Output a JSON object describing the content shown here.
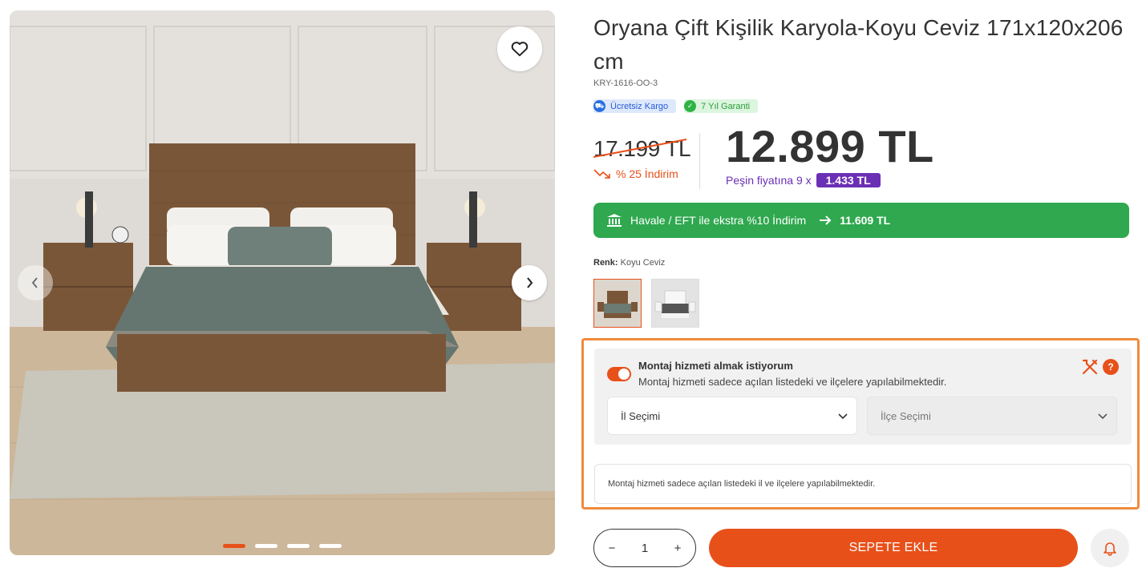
{
  "product": {
    "title": "Oryana Çift Kişilik Karyola-Koyu Ceviz 171x120x206 cm",
    "sku": "KRY-1616-OO-3",
    "badges": [
      {
        "label": "Ücretsiz Kargo",
        "icon": "shipping-icon"
      },
      {
        "label": "7 Yıl Garanti",
        "icon": "check-icon"
      }
    ]
  },
  "price": {
    "old": "17.199 TL",
    "discount": "% 25 İndirim",
    "current": "12.899 TL",
    "installment_text": "Peşin fiyatına 9 x",
    "installment_amount": "1.433 TL"
  },
  "havale": {
    "text": "Havale / EFT ile ekstra %10 İndirim",
    "amount": "11.609  TL"
  },
  "color": {
    "label": "Renk:",
    "value": "Koyu Ceviz",
    "options": [
      "Koyu Ceviz",
      "Beyaz"
    ],
    "selected_index": 0
  },
  "assembly": {
    "enabled": true,
    "title": "Montaj hizmeti almak istiyorum",
    "subtitle": "Montaj hizmeti sadece açılan listedeki ve ilçelere yapılabilmektedir.",
    "help": "?",
    "il_placeholder": "İl Seçimi",
    "ilce_placeholder": "İlçe Seçimi",
    "note": "Montaj hizmeti sadece açılan listedeki il ve ilçelere yapılabilmektedir."
  },
  "cart": {
    "quantity": "1",
    "minus": "−",
    "plus": "+",
    "button": "SEPETE EKLE"
  },
  "gallery": {
    "slide_count": 4,
    "active_slide": 0
  },
  "colors": {
    "accent": "#e8501a",
    "green": "#2fa84f",
    "purple": "#6b2fb5"
  }
}
